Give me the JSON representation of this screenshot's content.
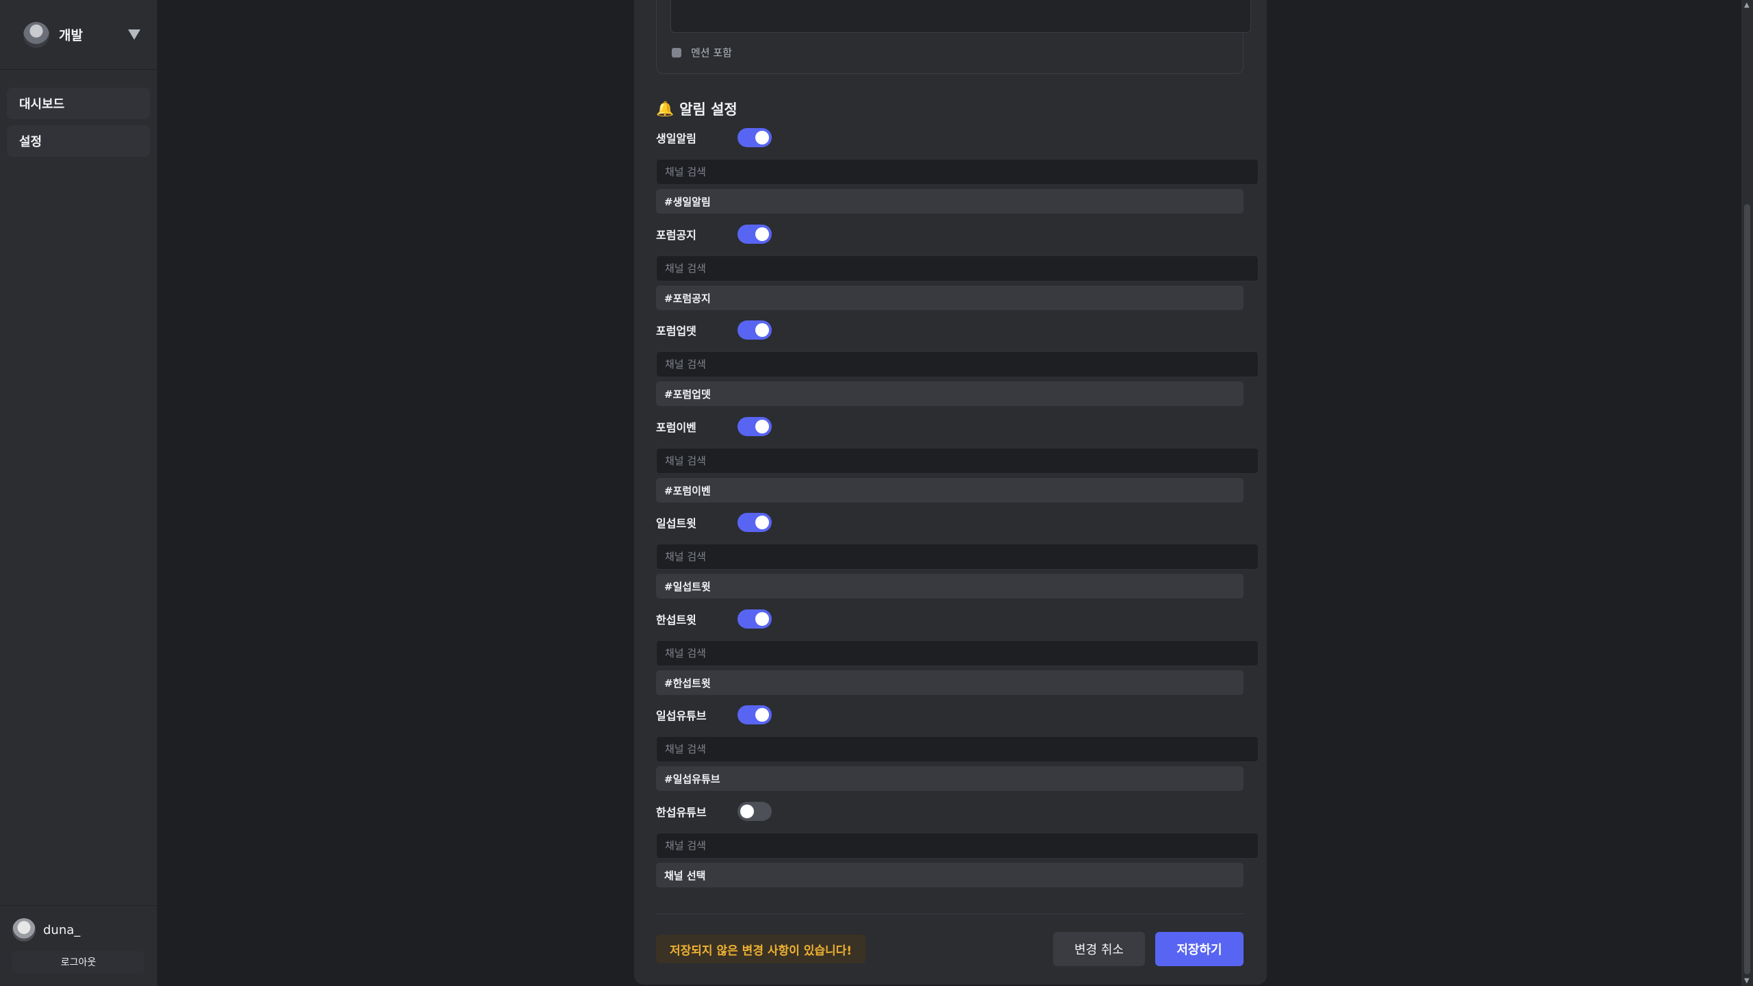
{
  "sidebar": {
    "server_name": "개발",
    "nav_items": [
      {
        "label": "대시보드"
      },
      {
        "label": "설정"
      }
    ],
    "user": {
      "name": "duna_",
      "logout_label": "로그아웃"
    }
  },
  "prev_section": {
    "mention_label": "멘션 포함"
  },
  "alerts": {
    "title": "알림 설정",
    "search_placeholder": "채널 검색",
    "items": [
      {
        "label": "생일알림",
        "enabled": true,
        "channel": "#생일알림"
      },
      {
        "label": "포럼공지",
        "enabled": true,
        "channel": "#포럼공지"
      },
      {
        "label": "포럼업뎃",
        "enabled": true,
        "channel": "#포럼업뎃"
      },
      {
        "label": "포럼이벤",
        "enabled": true,
        "channel": "#포럼이벤"
      },
      {
        "label": "일섭트윗",
        "enabled": true,
        "channel": "#일섭트윗"
      },
      {
        "label": "한섭트윗",
        "enabled": true,
        "channel": "#한섭트윗"
      },
      {
        "label": "일섭유튜브",
        "enabled": true,
        "channel": "#일섭유튜브"
      },
      {
        "label": "한섭유튜브",
        "enabled": false,
        "channel": "채널 선택"
      }
    ]
  },
  "footer": {
    "unsaved_notice": "저장되지 않은 변경 사항이 있습니다!",
    "cancel_label": "변경 취소",
    "save_label": "저장하기"
  },
  "colors": {
    "accent": "#5865f2",
    "warning": "#f0b232"
  }
}
